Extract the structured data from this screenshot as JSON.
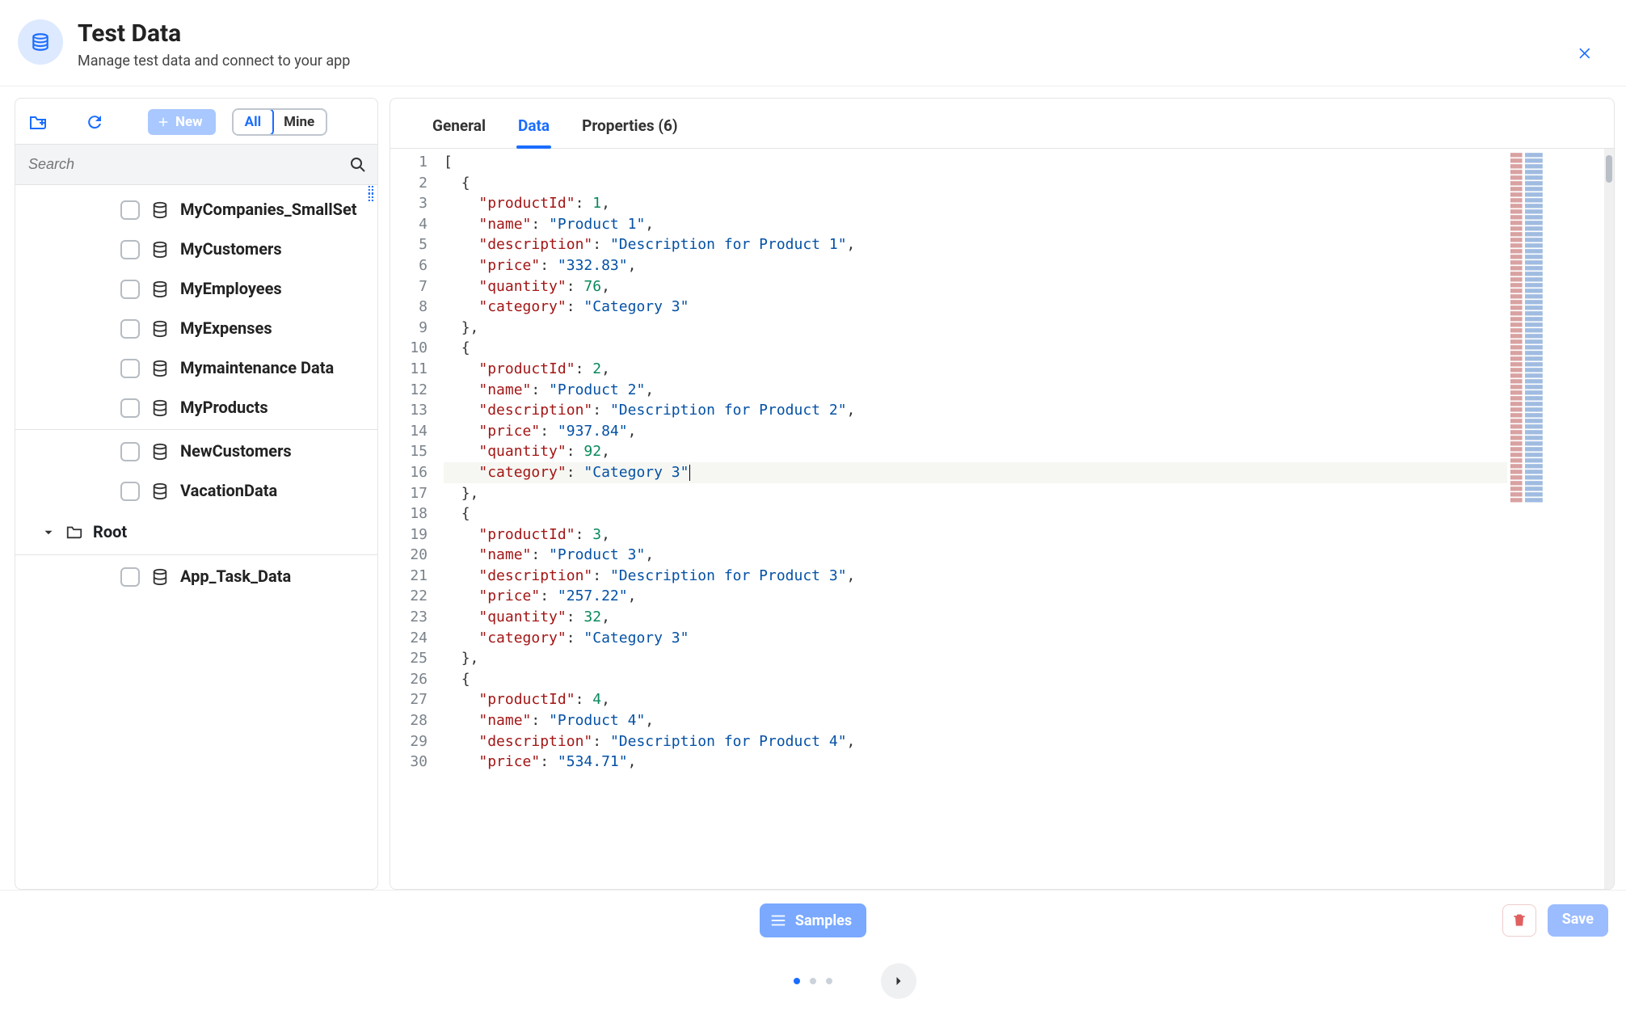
{
  "header": {
    "title": "Test Data",
    "subtitle": "Manage test data and connect to your app"
  },
  "toolbar": {
    "new_label": "New",
    "filter_all": "All",
    "filter_mine": "Mine",
    "search_placeholder": "Search"
  },
  "tree": {
    "items": [
      {
        "label": "MyCompanies_SmallSet"
      },
      {
        "label": "MyCustomers"
      },
      {
        "label": "MyEmployees"
      },
      {
        "label": "MyExpenses"
      },
      {
        "label": "Mymaintenance Data"
      },
      {
        "label": "MyProducts",
        "selected": true
      },
      {
        "label": "NewCustomers"
      },
      {
        "label": "VacationData"
      }
    ],
    "root_label": "Root",
    "root_children": [
      {
        "label": "App_Task_Data"
      }
    ]
  },
  "tabs": {
    "general": "General",
    "data": "Data",
    "properties": "Properties (6)",
    "active": "data"
  },
  "editor": {
    "cursor_line": 16,
    "lines": [
      {
        "n": 1,
        "tokens": [
          {
            "t": "[",
            "c": "p"
          }
        ]
      },
      {
        "n": 2,
        "tokens": [
          {
            "t": "  ",
            "c": "p"
          },
          {
            "t": "{",
            "c": "p"
          }
        ]
      },
      {
        "n": 3,
        "tokens": [
          {
            "t": "    ",
            "c": "p"
          },
          {
            "t": "\"productId\"",
            "c": "k"
          },
          {
            "t": ": ",
            "c": "p"
          },
          {
            "t": "1",
            "c": "n"
          },
          {
            "t": ",",
            "c": "p"
          }
        ]
      },
      {
        "n": 4,
        "tokens": [
          {
            "t": "    ",
            "c": "p"
          },
          {
            "t": "\"name\"",
            "c": "k"
          },
          {
            "t": ": ",
            "c": "p"
          },
          {
            "t": "\"Product 1\"",
            "c": "s"
          },
          {
            "t": ",",
            "c": "p"
          }
        ]
      },
      {
        "n": 5,
        "tokens": [
          {
            "t": "    ",
            "c": "p"
          },
          {
            "t": "\"description\"",
            "c": "k"
          },
          {
            "t": ": ",
            "c": "p"
          },
          {
            "t": "\"Description for Product 1\"",
            "c": "s"
          },
          {
            "t": ",",
            "c": "p"
          }
        ]
      },
      {
        "n": 6,
        "tokens": [
          {
            "t": "    ",
            "c": "p"
          },
          {
            "t": "\"price\"",
            "c": "k"
          },
          {
            "t": ": ",
            "c": "p"
          },
          {
            "t": "\"332.83\"",
            "c": "s"
          },
          {
            "t": ",",
            "c": "p"
          }
        ]
      },
      {
        "n": 7,
        "tokens": [
          {
            "t": "    ",
            "c": "p"
          },
          {
            "t": "\"quantity\"",
            "c": "k"
          },
          {
            "t": ": ",
            "c": "p"
          },
          {
            "t": "76",
            "c": "n"
          },
          {
            "t": ",",
            "c": "p"
          }
        ]
      },
      {
        "n": 8,
        "tokens": [
          {
            "t": "    ",
            "c": "p"
          },
          {
            "t": "\"category\"",
            "c": "k"
          },
          {
            "t": ": ",
            "c": "p"
          },
          {
            "t": "\"Category 3\"",
            "c": "s"
          }
        ]
      },
      {
        "n": 9,
        "tokens": [
          {
            "t": "  ",
            "c": "p"
          },
          {
            "t": "},",
            "c": "p"
          }
        ]
      },
      {
        "n": 10,
        "tokens": [
          {
            "t": "  ",
            "c": "p"
          },
          {
            "t": "{",
            "c": "p"
          }
        ]
      },
      {
        "n": 11,
        "tokens": [
          {
            "t": "    ",
            "c": "p"
          },
          {
            "t": "\"productId\"",
            "c": "k"
          },
          {
            "t": ": ",
            "c": "p"
          },
          {
            "t": "2",
            "c": "n"
          },
          {
            "t": ",",
            "c": "p"
          }
        ]
      },
      {
        "n": 12,
        "tokens": [
          {
            "t": "    ",
            "c": "p"
          },
          {
            "t": "\"name\"",
            "c": "k"
          },
          {
            "t": ": ",
            "c": "p"
          },
          {
            "t": "\"Product 2\"",
            "c": "s"
          },
          {
            "t": ",",
            "c": "p"
          }
        ]
      },
      {
        "n": 13,
        "tokens": [
          {
            "t": "    ",
            "c": "p"
          },
          {
            "t": "\"description\"",
            "c": "k"
          },
          {
            "t": ": ",
            "c": "p"
          },
          {
            "t": "\"Description for Product 2\"",
            "c": "s"
          },
          {
            "t": ",",
            "c": "p"
          }
        ]
      },
      {
        "n": 14,
        "tokens": [
          {
            "t": "    ",
            "c": "p"
          },
          {
            "t": "\"price\"",
            "c": "k"
          },
          {
            "t": ": ",
            "c": "p"
          },
          {
            "t": "\"937.84\"",
            "c": "s"
          },
          {
            "t": ",",
            "c": "p"
          }
        ]
      },
      {
        "n": 15,
        "tokens": [
          {
            "t": "    ",
            "c": "p"
          },
          {
            "t": "\"quantity\"",
            "c": "k"
          },
          {
            "t": ": ",
            "c": "p"
          },
          {
            "t": "92",
            "c": "n"
          },
          {
            "t": ",",
            "c": "p"
          }
        ]
      },
      {
        "n": 16,
        "tokens": [
          {
            "t": "    ",
            "c": "p"
          },
          {
            "t": "\"category\"",
            "c": "k"
          },
          {
            "t": ": ",
            "c": "p"
          },
          {
            "t": "\"Category 3\"",
            "c": "s"
          }
        ]
      },
      {
        "n": 17,
        "tokens": [
          {
            "t": "  ",
            "c": "p"
          },
          {
            "t": "},",
            "c": "p"
          }
        ]
      },
      {
        "n": 18,
        "tokens": [
          {
            "t": "  ",
            "c": "p"
          },
          {
            "t": "{",
            "c": "p"
          }
        ]
      },
      {
        "n": 19,
        "tokens": [
          {
            "t": "    ",
            "c": "p"
          },
          {
            "t": "\"productId\"",
            "c": "k"
          },
          {
            "t": ": ",
            "c": "p"
          },
          {
            "t": "3",
            "c": "n"
          },
          {
            "t": ",",
            "c": "p"
          }
        ]
      },
      {
        "n": 20,
        "tokens": [
          {
            "t": "    ",
            "c": "p"
          },
          {
            "t": "\"name\"",
            "c": "k"
          },
          {
            "t": ": ",
            "c": "p"
          },
          {
            "t": "\"Product 3\"",
            "c": "s"
          },
          {
            "t": ",",
            "c": "p"
          }
        ]
      },
      {
        "n": 21,
        "tokens": [
          {
            "t": "    ",
            "c": "p"
          },
          {
            "t": "\"description\"",
            "c": "k"
          },
          {
            "t": ": ",
            "c": "p"
          },
          {
            "t": "\"Description for Product 3\"",
            "c": "s"
          },
          {
            "t": ",",
            "c": "p"
          }
        ]
      },
      {
        "n": 22,
        "tokens": [
          {
            "t": "    ",
            "c": "p"
          },
          {
            "t": "\"price\"",
            "c": "k"
          },
          {
            "t": ": ",
            "c": "p"
          },
          {
            "t": "\"257.22\"",
            "c": "s"
          },
          {
            "t": ",",
            "c": "p"
          }
        ]
      },
      {
        "n": 23,
        "tokens": [
          {
            "t": "    ",
            "c": "p"
          },
          {
            "t": "\"quantity\"",
            "c": "k"
          },
          {
            "t": ": ",
            "c": "p"
          },
          {
            "t": "32",
            "c": "n"
          },
          {
            "t": ",",
            "c": "p"
          }
        ]
      },
      {
        "n": 24,
        "tokens": [
          {
            "t": "    ",
            "c": "p"
          },
          {
            "t": "\"category\"",
            "c": "k"
          },
          {
            "t": ": ",
            "c": "p"
          },
          {
            "t": "\"Category 3\"",
            "c": "s"
          }
        ]
      },
      {
        "n": 25,
        "tokens": [
          {
            "t": "  ",
            "c": "p"
          },
          {
            "t": "},",
            "c": "p"
          }
        ]
      },
      {
        "n": 26,
        "tokens": [
          {
            "t": "  ",
            "c": "p"
          },
          {
            "t": "{",
            "c": "p"
          }
        ]
      },
      {
        "n": 27,
        "tokens": [
          {
            "t": "    ",
            "c": "p"
          },
          {
            "t": "\"productId\"",
            "c": "k"
          },
          {
            "t": ": ",
            "c": "p"
          },
          {
            "t": "4",
            "c": "n"
          },
          {
            "t": ",",
            "c": "p"
          }
        ]
      },
      {
        "n": 28,
        "tokens": [
          {
            "t": "    ",
            "c": "p"
          },
          {
            "t": "\"name\"",
            "c": "k"
          },
          {
            "t": ": ",
            "c": "p"
          },
          {
            "t": "\"Product 4\"",
            "c": "s"
          },
          {
            "t": ",",
            "c": "p"
          }
        ]
      },
      {
        "n": 29,
        "tokens": [
          {
            "t": "    ",
            "c": "p"
          },
          {
            "t": "\"description\"",
            "c": "k"
          },
          {
            "t": ": ",
            "c": "p"
          },
          {
            "t": "\"Description for Product 4\"",
            "c": "s"
          },
          {
            "t": ",",
            "c": "p"
          }
        ]
      },
      {
        "n": 30,
        "tokens": [
          {
            "t": "    ",
            "c": "p"
          },
          {
            "t": "\"price\"",
            "c": "k"
          },
          {
            "t": ": ",
            "c": "p"
          },
          {
            "t": "\"534.71\"",
            "c": "s"
          },
          {
            "t": ",",
            "c": "p"
          }
        ]
      }
    ]
  },
  "footer": {
    "samples": "Samples",
    "save": "Save"
  }
}
